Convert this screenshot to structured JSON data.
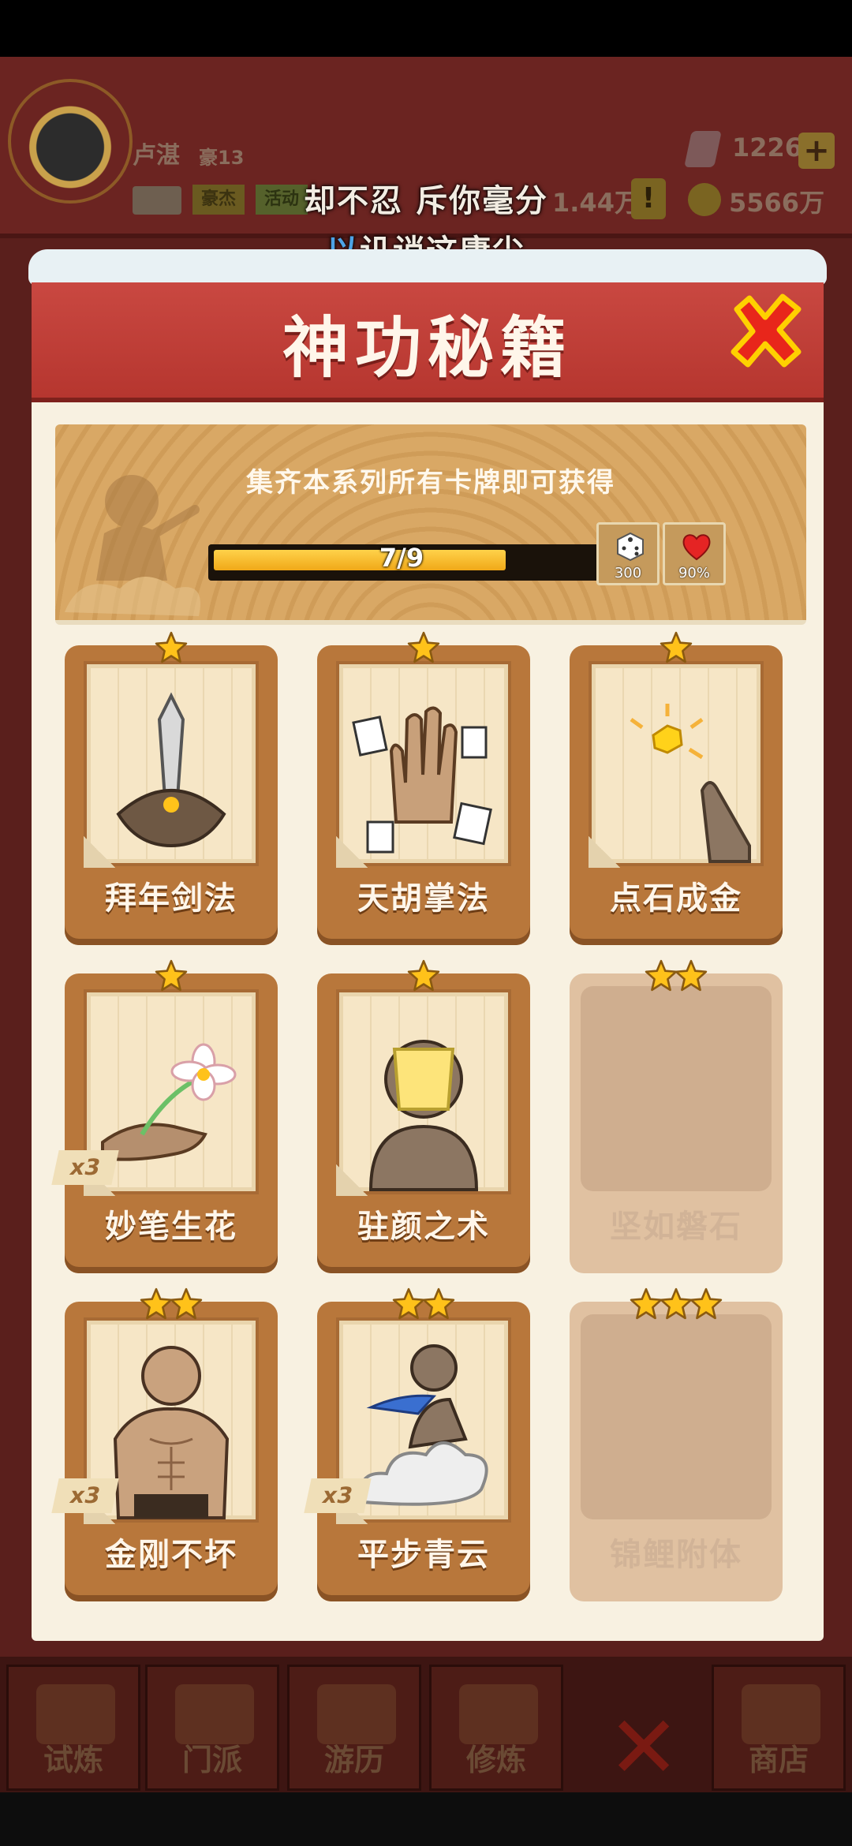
{
  "hud": {
    "player_name": "卢湛",
    "vip_rank": "豪13",
    "gems": "1226",
    "plus": "+",
    "hero_tag": "豪杰",
    "activity_tag": "活动",
    "population": "1.44万",
    "alert": "!",
    "coins": "5566万"
  },
  "caption": {
    "line1": "却不忍 斥你毫分",
    "line2_highlight": "以",
    "line2_rest": "讥诮这庸尘"
  },
  "modal": {
    "title": "神功秘籍",
    "banner_text": "集齐本系列所有卡牌即可获得",
    "progress": {
      "current": 7,
      "total": 9,
      "label": "7/9"
    },
    "rewards": [
      {
        "icon": "dice-icon",
        "value": "300"
      },
      {
        "icon": "heart-icon",
        "value": "90%"
      }
    ]
  },
  "cards": [
    {
      "name": "拜年剑法",
      "stars": 1,
      "locked": false,
      "badge": "",
      "art": "sword"
    },
    {
      "name": "天胡掌法",
      "stars": 1,
      "locked": false,
      "badge": "",
      "art": "palm"
    },
    {
      "name": "点石成金",
      "stars": 1,
      "locked": false,
      "badge": "",
      "art": "gold"
    },
    {
      "name": "妙笔生花",
      "stars": 1,
      "locked": false,
      "badge": "x3",
      "art": "flower"
    },
    {
      "name": "驻颜之术",
      "stars": 1,
      "locked": false,
      "badge": "",
      "art": "mask"
    },
    {
      "name": "坚如磐石",
      "stars": 2,
      "locked": true,
      "badge": "",
      "art": ""
    },
    {
      "name": "金刚不坏",
      "stars": 2,
      "locked": false,
      "badge": "x3",
      "art": "muscle"
    },
    {
      "name": "平步青云",
      "stars": 2,
      "locked": false,
      "badge": "x3",
      "art": "cloud"
    },
    {
      "name": "锦鲤附体",
      "stars": 3,
      "locked": true,
      "badge": "",
      "art": ""
    }
  ],
  "nav": [
    "试炼",
    "门派",
    "游历",
    "修炼",
    "",
    "商店"
  ],
  "colors": {
    "header_red": "#c94841",
    "star_gold": "#ffc21a",
    "card_brown": "#b8773b",
    "progress_gold": "#f0a818"
  }
}
